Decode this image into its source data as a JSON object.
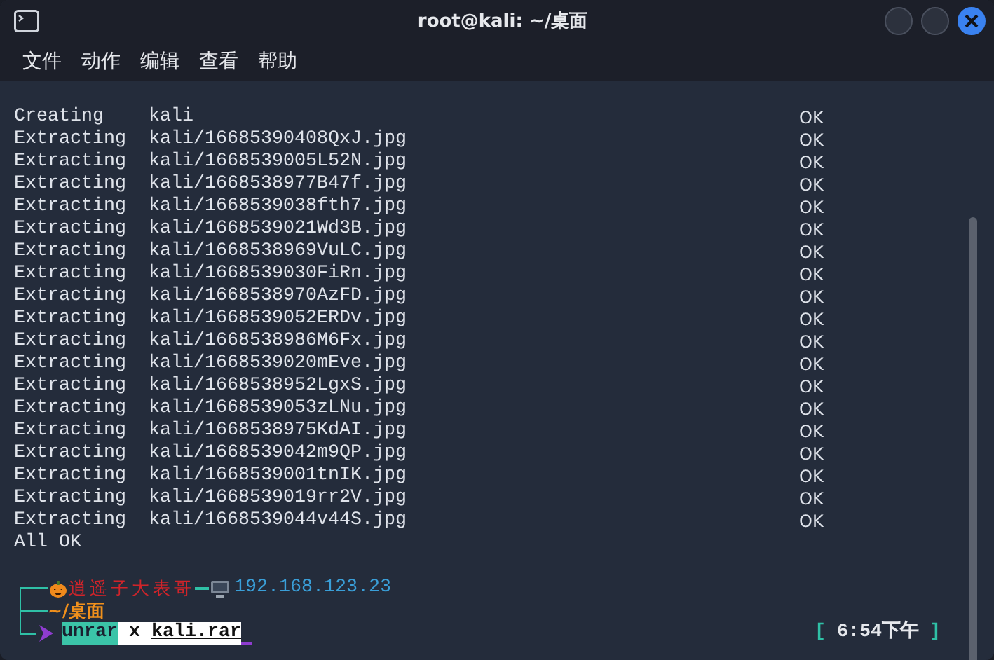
{
  "window": {
    "title": "root@kali: ~/桌面"
  },
  "menu": [
    "文件",
    "动作",
    "编辑",
    "查看",
    "帮助"
  ],
  "output": [
    {
      "action": "Creating",
      "path": "kali",
      "status": "OK"
    },
    {
      "action": "Extracting",
      "path": "kali/16685390408QxJ.jpg",
      "status": "OK"
    },
    {
      "action": "Extracting",
      "path": "kali/1668539005L52N.jpg",
      "status": "OK"
    },
    {
      "action": "Extracting",
      "path": "kali/1668538977B47f.jpg",
      "status": "OK"
    },
    {
      "action": "Extracting",
      "path": "kali/1668539038fth7.jpg",
      "status": "OK"
    },
    {
      "action": "Extracting",
      "path": "kali/1668539021Wd3B.jpg",
      "status": "OK"
    },
    {
      "action": "Extracting",
      "path": "kali/1668538969VuLC.jpg",
      "status": "OK"
    },
    {
      "action": "Extracting",
      "path": "kali/1668539030FiRn.jpg",
      "status": "OK"
    },
    {
      "action": "Extracting",
      "path": "kali/1668538970AzFD.jpg",
      "status": "OK"
    },
    {
      "action": "Extracting",
      "path": "kali/1668539052ERDv.jpg",
      "status": "OK"
    },
    {
      "action": "Extracting",
      "path": "kali/1668538986M6Fx.jpg",
      "status": "OK"
    },
    {
      "action": "Extracting",
      "path": "kali/1668539020mEve.jpg",
      "status": "OK"
    },
    {
      "action": "Extracting",
      "path": "kali/1668538952LgxS.jpg",
      "status": "OK"
    },
    {
      "action": "Extracting",
      "path": "kali/1668539053zLNu.jpg",
      "status": "OK"
    },
    {
      "action": "Extracting",
      "path": "kali/1668538975KdAI.jpg",
      "status": "OK"
    },
    {
      "action": "Extracting",
      "path": "kali/1668539042m9QP.jpg",
      "status": "OK"
    },
    {
      "action": "Extracting",
      "path": "kali/1668539001tnIK.jpg",
      "status": "OK"
    },
    {
      "action": "Extracting",
      "path": "kali/1668539019rr2V.jpg",
      "status": "OK"
    },
    {
      "action": "Extracting",
      "path": "kali/1668539044v44S.jpg",
      "status": "OK"
    }
  ],
  "summary": "All OK",
  "prompt": {
    "user": "逍遥子大表哥",
    "host": "192.168.123.23",
    "cwd": "~/桌面",
    "command": {
      "program": "unrar",
      "args": "x",
      "file": "kali.rar"
    }
  },
  "clock": {
    "open": "[",
    "time": "6:54下午",
    "close": "]"
  }
}
